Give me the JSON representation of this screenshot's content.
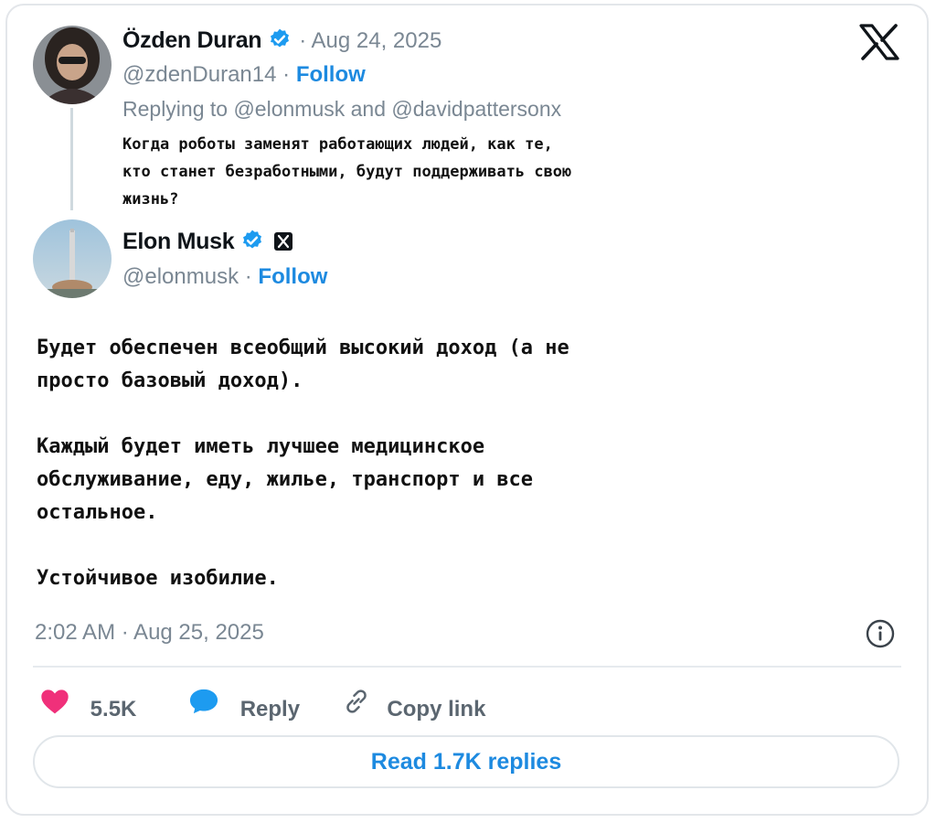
{
  "reply_tweet": {
    "author_name": "Özden Duran",
    "date": "· Aug 24, 2025",
    "handle": "@zdenDuran14 ·",
    "follow_label": "Follow",
    "replying_to": "Replying to @elonmusk and @davidpattersonx",
    "text_lines": [
      "Когда роботы заменят работающих людей, как те,",
      "кто станет безработными, будут поддерживать свою",
      "жизнь?"
    ]
  },
  "main_tweet": {
    "author_name": "Elon Musk",
    "handle": "@elonmusk ·",
    "follow_label": "Follow",
    "text_lines": [
      "Будет обеспечен всеобщий высокий доход (а не",
      "просто базовый доход).",
      "Каждый будет иметь лучшее медицинское",
      "обслуживание, еду, жилье, транспорт и все",
      "остальное.",
      "Устойчивое изобилие."
    ],
    "timestamp": "2:02 AM · Aug 25, 2025"
  },
  "actions": {
    "likes": "5.5K",
    "reply_label": "Reply",
    "copy_link_label": "Copy link",
    "read_replies_label": "Read 1.7K replies"
  },
  "icons": {
    "x_logo": "x-logo-icon",
    "verified": "verified-badge-icon",
    "info": "info-icon",
    "like": "heart-icon",
    "reply": "speech-bubble-icon",
    "link": "link-icon"
  },
  "colors": {
    "accent": "#1d8ae0",
    "like": "#f0307a",
    "verified": "#1d9bf0",
    "muted": "#7a8793"
  }
}
